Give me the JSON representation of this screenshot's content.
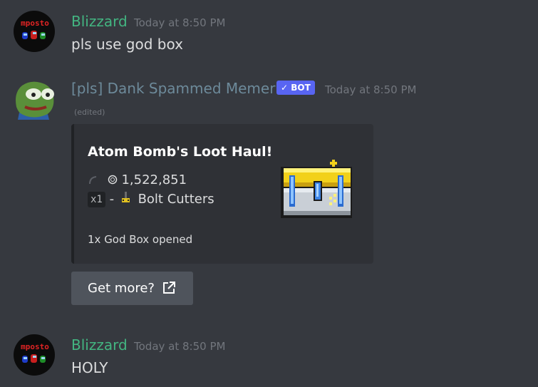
{
  "messages": [
    {
      "username": "Blizzard",
      "timestamp": "Today at 8:50 PM",
      "avatar_text": "mposto",
      "text": "pls use god box"
    },
    {
      "username": "[pls] Dank Spammed Memer",
      "bot_tag": "BOT",
      "timestamp": "Today at 8:50 PM",
      "edited": "(edited)",
      "embed": {
        "title": "Atom Bomb's Loot Haul!",
        "coins": "1,522,851",
        "item_qty": "x1",
        "item_sep": "-",
        "item_name": "Bolt Cutters",
        "footer": "1x God Box opened"
      },
      "button": {
        "label": "Get more?"
      }
    },
    {
      "username": "Blizzard",
      "timestamp": "Today at 8:50 PM",
      "avatar_text": "mposto",
      "text": "HOLY"
    }
  ],
  "colors": {
    "background": "#36393f",
    "username_green": "#43b581",
    "bot_name": "#6d8a9a",
    "bot_tag": "#5865f2",
    "embed_bg": "#2f3136",
    "button_bg": "#4f545c"
  },
  "icons": [
    "coin-icon",
    "bolt-cutters-icon",
    "external-link-icon",
    "chest-icon",
    "check-icon"
  ]
}
